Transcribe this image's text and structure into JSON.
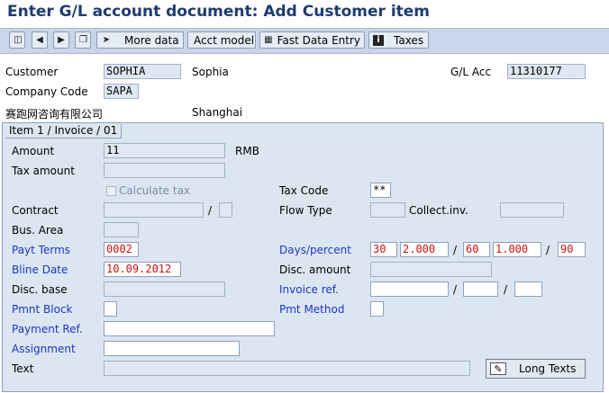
{
  "window": {
    "title": "Enter G/L account document: Add Customer item"
  },
  "toolbar": {
    "icons": [
      "prev-doc-icon",
      "first-icon",
      "next-icon",
      "copy-icon"
    ],
    "more_data": "More data",
    "acct_model": "Acct model",
    "fast_entry": "Fast Data Entry",
    "taxes": "Taxes"
  },
  "header": {
    "customer_label": "Customer",
    "customer_value": "SOPHIA",
    "customer_name": "Sophia",
    "gl_label": "G/L Acc",
    "gl_value": "11310177",
    "company_label": "Company Code",
    "company_value": "SAPA",
    "company_name": "赛跑网咨询有限公司",
    "city": "Shanghai"
  },
  "item": {
    "tab_label": "Item 1 / Invoice / 01",
    "amount_label": "Amount",
    "amount_value": "11",
    "currency": "RMB",
    "tax_amount_label": "Tax amount",
    "calc_tax_label": "Calculate tax",
    "tax_code_label": "Tax Code",
    "tax_code_value": "**",
    "contract_label": "Contract",
    "flow_type_label": "Flow Type",
    "collect_inv_label": "Collect.inv.",
    "bus_area_label": "Bus. Area",
    "payt_terms_label": "Payt Terms",
    "payt_terms_value": "0002",
    "days_percent_label": "Days/percent",
    "days1": "30",
    "pct1": "2.000",
    "days2": "60",
    "pct2": "1.000",
    "days3": "90",
    "bline_label": "Bline Date",
    "bline_value": "10.09.2012",
    "disc_amount_label": "Disc. amount",
    "disc_base_label": "Disc. base",
    "invoice_ref_label": "Invoice ref.",
    "pmnt_block_label": "Pmnt Block",
    "pmt_method_label": "Pmt Method",
    "payment_ref_label": "Payment Ref.",
    "assignment_label": "Assignment",
    "text_label": "Text",
    "long_texts_label": "Long Texts"
  }
}
